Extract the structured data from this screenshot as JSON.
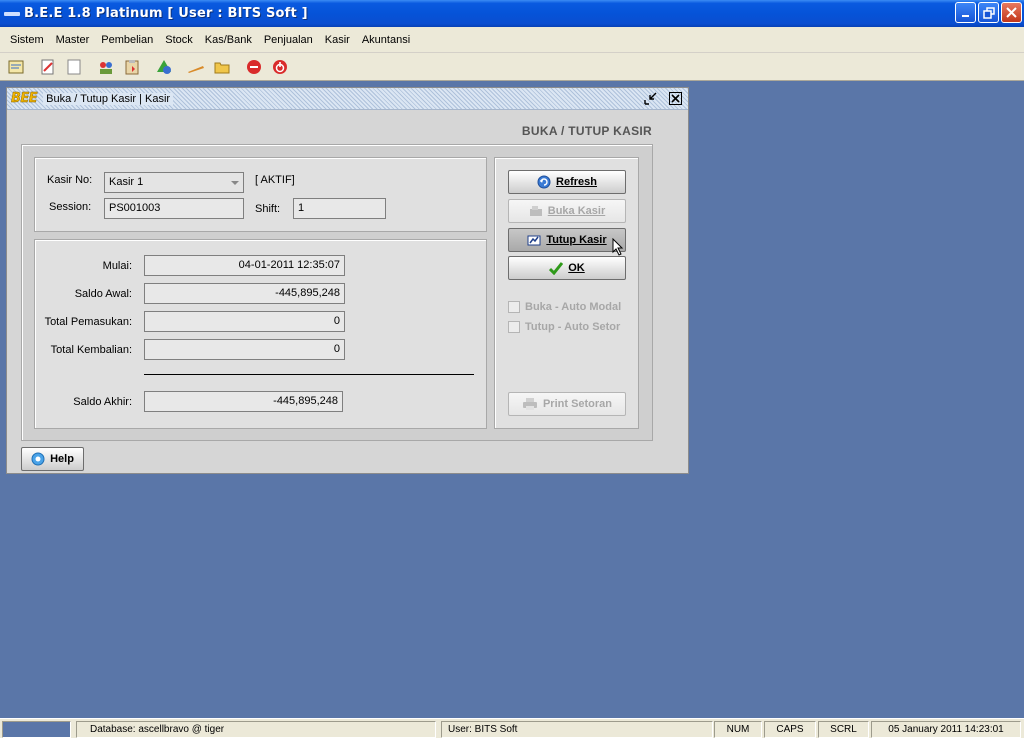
{
  "window": {
    "title": "B.E.E 1.8 Platinum [ User : BITS Soft ]"
  },
  "menu": [
    "Sistem",
    "Master",
    "Pembelian",
    "Stock",
    "Kas/Bank",
    "Penjualan",
    "Kasir",
    "Akuntansi"
  ],
  "frame": {
    "logo": "BEE",
    "title": "Buka / Tutup Kasir | Kasir",
    "heading": "BUKA / TUTUP KASIR"
  },
  "form": {
    "kasir_no_label": "Kasir No:",
    "kasir_no_value": "Kasir 1",
    "status": "[ AKTIF]",
    "session_label": "Session:",
    "session_value": "PS001003",
    "shift_label": "Shift:",
    "shift_value": "1"
  },
  "summary": {
    "mulai_label": "Mulai:",
    "mulai_value": "04-01-2011 12:35:07",
    "saldo_awal_label": "Saldo Awal:",
    "saldo_awal_value": "-445,895,248",
    "total_pemasukan_label": "Total Pemasukan:",
    "total_pemasukan_value": "0",
    "total_kembalian_label": "Total Kembalian:",
    "total_kembalian_value": "0",
    "saldo_akhir_label": "Saldo Akhir:",
    "saldo_akhir_value": "-445,895,248"
  },
  "actions": {
    "refresh": "Refresh",
    "buka_kasir": "Buka Kasir",
    "tutup_kasir": "Tutup Kasir",
    "ok": "OK",
    "auto_modal": "Buka - Auto Modal",
    "auto_setor": "Tutup - Auto Setor",
    "print_setoran": "Print Setoran",
    "help": "Help"
  },
  "status": {
    "database": "Database: ascellbravo @ tiger",
    "user": "User: BITS Soft",
    "num": "NUM",
    "caps": "CAPS",
    "scrl": "SCRL",
    "datetime": "05 January 2011  14:23:01"
  },
  "colors": {
    "desktop": "#5a76a8",
    "titlebar": "#0553d8",
    "form": "#d6d6d6",
    "ok_check": "#2f9a1a"
  }
}
